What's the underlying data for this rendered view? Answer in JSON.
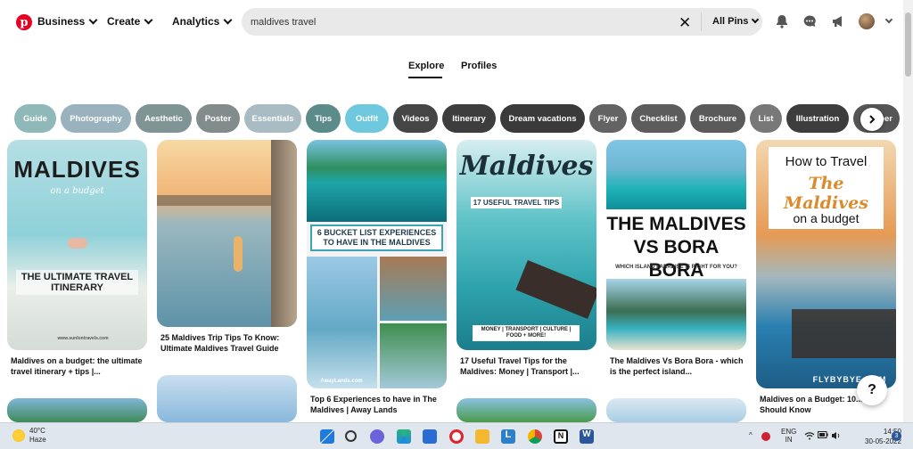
{
  "header": {
    "business": "Business",
    "create": "Create",
    "analytics": "Analytics",
    "search_value": "maldives travel",
    "scope": "All Pins"
  },
  "tabs": [
    {
      "label": "Explore",
      "active": true
    },
    {
      "label": "Profiles",
      "active": false
    }
  ],
  "chips": [
    {
      "label": "Guide",
      "color": "#8fb8b8"
    },
    {
      "label": "Photography",
      "color": "#9ab2bd"
    },
    {
      "label": "Aesthetic",
      "color": "#7f9494"
    },
    {
      "label": "Poster",
      "color": "#838c8c"
    },
    {
      "label": "Essentials",
      "color": "#a9bcc4"
    },
    {
      "label": "Tips",
      "color": "#5c8c8a"
    },
    {
      "label": "Outfit",
      "color": "#6ec9df"
    },
    {
      "label": "Videos",
      "color": "#454545"
    },
    {
      "label": "Itinerary",
      "color": "#3d3d3d"
    },
    {
      "label": "Dream vacations",
      "color": "#3a3a3a"
    },
    {
      "label": "Flyer",
      "color": "#636363"
    },
    {
      "label": "Checklist",
      "color": "#5c5c5c"
    },
    {
      "label": "Brochure",
      "color": "#5a5a5a"
    },
    {
      "label": "List",
      "color": "#787878"
    },
    {
      "label": "Illustration",
      "color": "#3d3d3d"
    },
    {
      "label": "Paper",
      "color": "#555555"
    }
  ],
  "pins": [
    {
      "title": "Maldives on a budget: the ultimate travel itinerary + tips |...",
      "img_big": "MALDIVES",
      "img_script": "on a budget",
      "img_sub": "THE ULTIMATE TRAVEL ITINERARY",
      "img_small": "www.sunlontravels.com"
    },
    {
      "title": "25 Maldives Trip Tips To Know: Ultimate Maldives Travel Guide"
    },
    {
      "title": "Top 6 Experiences to have in The Maldives | Away Lands",
      "img_big": "6 BUCKET LIST EXPERIENCES TO HAVE IN THE MALDIVES",
      "img_small": "AwayLands.com"
    },
    {
      "title": "17 Useful Travel Tips for the Maldives: Money | Transport |...",
      "img_script": "Maldives",
      "img_sub": "17 USEFUL TRAVEL TIPS",
      "img_small": "MONEY | TRANSPORT | CULTURE | FOOD + MORE!"
    },
    {
      "title": "The Maldives Vs Bora Bora - which is the perfect island...",
      "img_big": "THE MALDIVES VS BORA BORA",
      "img_sub": "WHICH ISLAND PARADISE IS RIGHT FOR YOU?"
    },
    {
      "title": "Maldives on a Budget: 10... You Should Know",
      "img_big": "How to Travel",
      "img_script": "The Maldives",
      "img_sub": "on a budget",
      "img_small": "FLYBYBYE.COM"
    }
  ],
  "help": "?",
  "taskbar": {
    "temp": "40°C",
    "condition": "Haze",
    "lang_top": "ENG",
    "lang_bottom": "IN",
    "time": "14:50",
    "date": "30-05-2022",
    "notif_count": "3"
  }
}
